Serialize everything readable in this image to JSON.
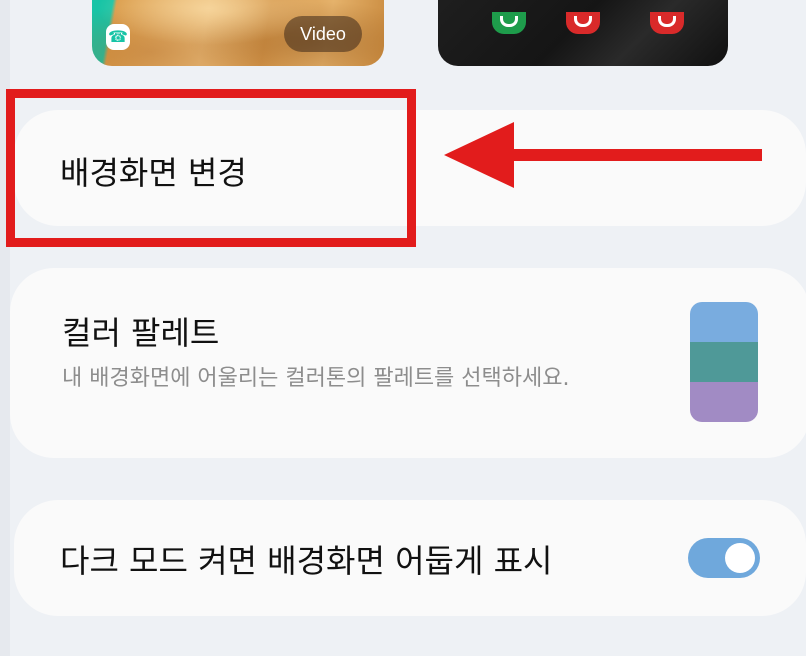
{
  "previews": {
    "video_label": "Video"
  },
  "settings": {
    "change_wallpaper": {
      "title": "배경화면 변경"
    },
    "color_palette": {
      "title": "컬러 팔레트",
      "subtitle": "내 배경화면에 어울리는 컬러톤의 팔레트를 선택하세요.",
      "swatch_colors": [
        "#79acdf",
        "#4f9998",
        "#a18bc4"
      ]
    },
    "dark_mode_dim": {
      "title": "다크 모드 켜면 배경화면 어둡게 표시",
      "enabled": true
    }
  },
  "colors": {
    "background": "#eef1f5",
    "card": "#fafafa",
    "annotation": "#e21c1c",
    "toggle_on": "#6fa8dc"
  }
}
